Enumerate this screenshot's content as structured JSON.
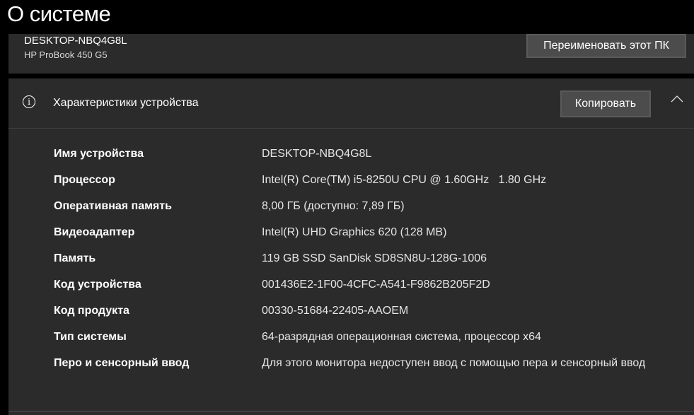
{
  "page_title": "О системе",
  "device": {
    "name": "DESKTOP-NBQ4G8L",
    "model": "HP ProBook 450 G5",
    "rename_button": "Переименовать этот ПК"
  },
  "specs": {
    "header": "Характеристики устройства",
    "copy_button": "Копировать",
    "info_icon": "i",
    "chevron_icon": "^",
    "rows": [
      {
        "label": "Имя устройства",
        "value": "DESKTOP-NBQ4G8L"
      },
      {
        "label": "Процессор",
        "value": "Intel(R) Core(TM) i5-8250U CPU @ 1.60GHz   1.80 GHz"
      },
      {
        "label": "Оперативная память",
        "value": "8,00 ГБ (доступно: 7,89 ГБ)"
      },
      {
        "label": "Видеоадаптер",
        "value": "Intel(R) UHD Graphics 620 (128 MB)"
      },
      {
        "label": "Память",
        "value": "119 GB SSD SanDisk SD8SN8U-128G-1006"
      },
      {
        "label": "Код устройства",
        "value": "001436E2-1F00-4CFC-A541-F9862B205F2D"
      },
      {
        "label": "Код продукта",
        "value": "00330-51684-22405-AAOEM"
      },
      {
        "label": "Тип системы",
        "value": "64-разрядная операционная система, процессор x64"
      },
      {
        "label": "Перо и сенсорный ввод",
        "value": "Для этого монитора недоступен ввод с помощью пера и сенсорный ввод"
      }
    ]
  }
}
